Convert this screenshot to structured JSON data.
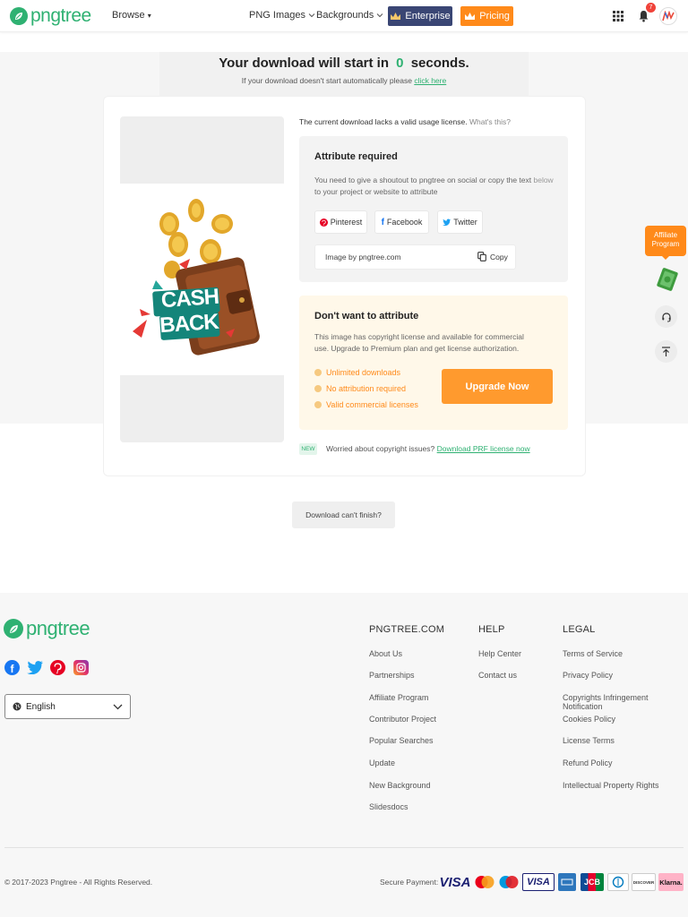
{
  "header": {
    "logo_text": "pngtree",
    "browse_label": "Browse",
    "nav_png": "PNG Images",
    "nav_backgrounds": "Backgrounds",
    "enterprise_label": "Enterprise",
    "pricing_label": "Pricing",
    "notification_count": "7"
  },
  "download": {
    "title_prefix": "Your download will start in",
    "countdown": "0",
    "title_suffix": "seconds.",
    "auto_text": "If your download doesn't start automatically please",
    "click_here": "click here"
  },
  "license_notice": {
    "text": "The current download lacks a valid usage license.",
    "whats_this": "What's this?"
  },
  "image": {
    "cash_line1": "CASH",
    "cash_line2": "BACK"
  },
  "attribute": {
    "title": "Attribute required",
    "desc_main": "You need to give a shoutout to pngtree on social or copy the text",
    "desc_below": "below",
    "desc_end": "to your project or website to attribute",
    "pinterest": "Pinterest",
    "facebook": "Facebook",
    "twitter": "Twitter",
    "credit_text": "Image by pngtree.com",
    "copy_label": "Copy"
  },
  "premium": {
    "title": "Don't want to attribute",
    "desc": "This image has copyright license and available for commercial use. Upgrade to Premium plan and get license authorization.",
    "features": [
      "Unlimited downloads",
      "No attribution required",
      "Valid commercial licenses"
    ],
    "upgrade_label": "Upgrade Now"
  },
  "copyright_bar": {
    "badge": "NEW",
    "text": "Worried about copyright issues?",
    "link": "Download PRF license now"
  },
  "cant_finish": "Download can't finish?",
  "side": {
    "affiliate_label": "Affiliate Program"
  },
  "footer": {
    "logo_text": "pngtree",
    "language": "English",
    "col1_title": "PNGTREE.COM",
    "col1_links": [
      "About Us",
      "Partnerships",
      "Affiliate Program",
      "Contributor Project",
      "Popular Searches",
      "Update",
      "New Background",
      "Slidesdocs"
    ],
    "col2_title": "HELP",
    "col2_links": [
      "Help Center",
      "Contact us"
    ],
    "col3_title": "LEGAL",
    "col3_links": [
      "Terms of Service",
      "Privacy Policy",
      "Copyrights Infringement Notification",
      "Cookies Policy",
      "License Terms",
      "Refund Policy",
      "Intellectual Property Rights"
    ],
    "copyright": "2017-2023 Pngtree - All Rights Reserved.",
    "secure_payment": "Secure Payment:",
    "payments": [
      "VISA",
      "VISA",
      "JCB",
      "DISCOVER",
      "Klarna."
    ]
  },
  "colors": {
    "brand_green": "#2fb172",
    "orange": "#ff8a1a",
    "enterprise_navy": "#3a4674"
  }
}
